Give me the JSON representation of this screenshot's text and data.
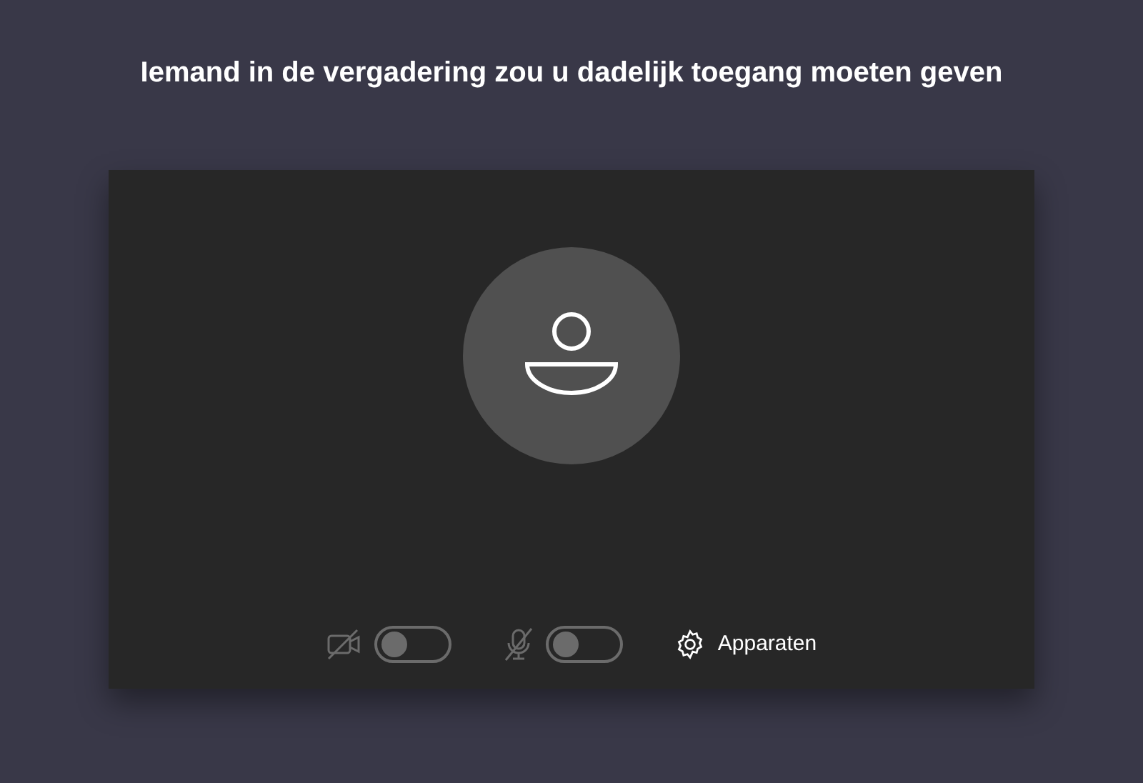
{
  "title": "Iemand in de vergadering zou u dadelijk toegang moeten geven",
  "toggles": [
    {
      "kind": "camera",
      "on": false
    },
    {
      "kind": "microphone",
      "on": false
    }
  ],
  "devices_button": {
    "label": "Apparaten"
  }
}
